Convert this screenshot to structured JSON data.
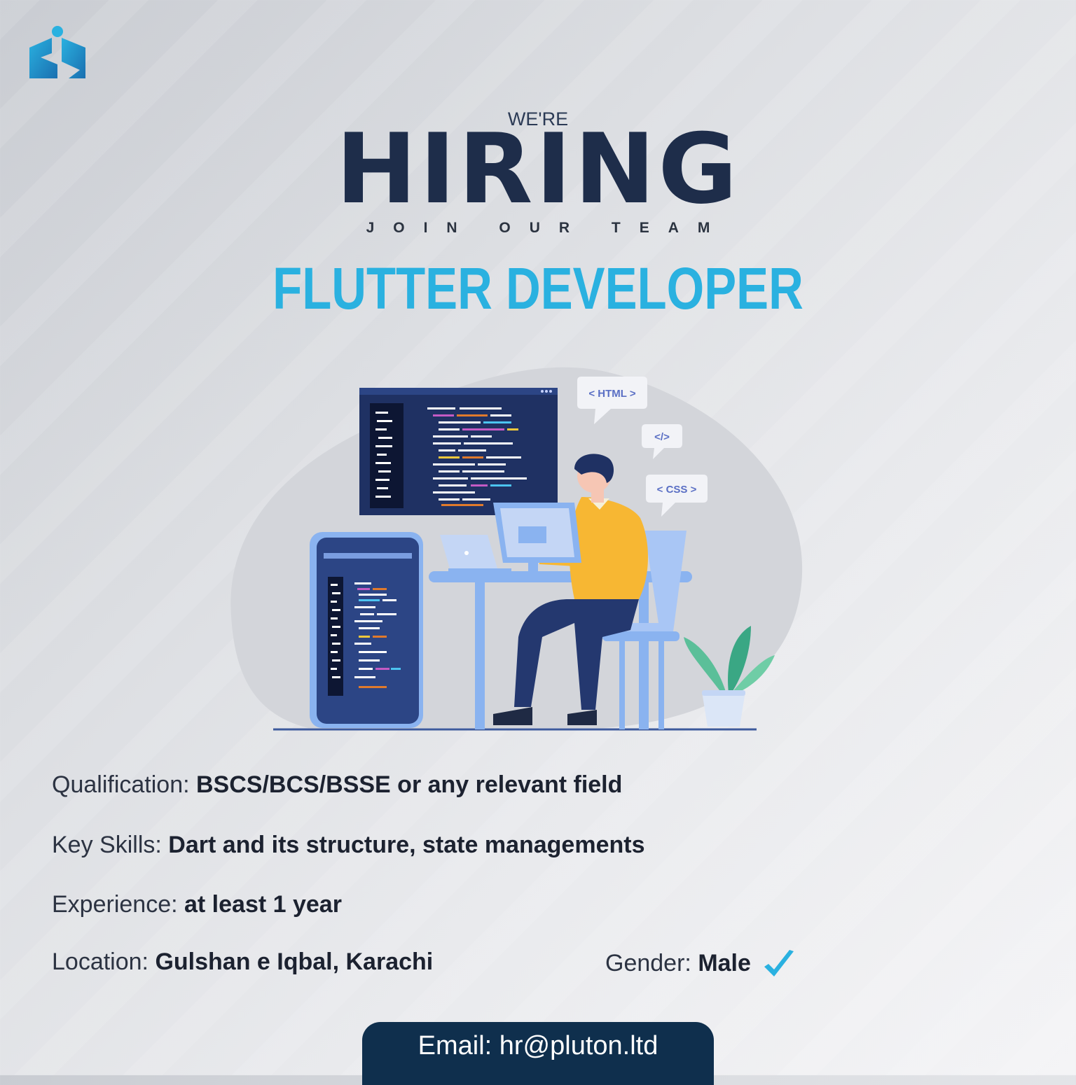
{
  "header": {
    "were": "WE'RE",
    "hiring": "HIRING",
    "tagline": "JOIN OUR TEAM",
    "role": "FLUTTER DEVELOPER"
  },
  "illustration": {
    "tags": [
      "< HTML >",
      "</>",
      "< CSS >"
    ]
  },
  "details": {
    "qualification": {
      "label": "Qualification:",
      "value": "BSCS/BCS/BSSE or any relevant field"
    },
    "skills": {
      "label": "Key Skills:",
      "value": "Dart and its structure, state managements"
    },
    "experience": {
      "label": "Experience:",
      "value": "at least 1 year"
    },
    "location": {
      "label": "Location:",
      "value": "Gulshan e Iqbal, Karachi"
    },
    "gender": {
      "label": "Gender:",
      "value": "Male"
    }
  },
  "contact": {
    "email_text": "Email: hr@pluton.ltd"
  },
  "colors": {
    "accent": "#2ab1e0",
    "navy": "#1e2d4a",
    "email_bar": "#0f2f4d"
  },
  "icons": [
    "logo-icon",
    "check-icon"
  ]
}
